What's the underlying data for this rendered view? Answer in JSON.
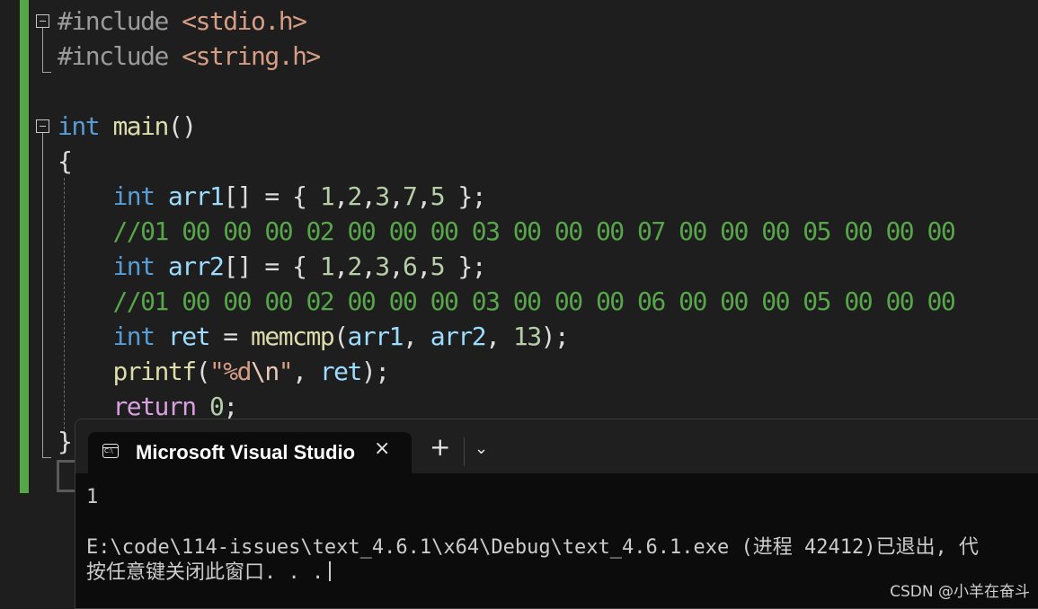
{
  "editor": {
    "lines": [
      {
        "id": "l1",
        "tokens": [
          {
            "t": "#include ",
            "c": "pp"
          },
          {
            "t": "<stdio.h>",
            "c": "inc"
          }
        ]
      },
      {
        "id": "l2",
        "tokens": [
          {
            "t": "#include ",
            "c": "pp"
          },
          {
            "t": "<string.h>",
            "c": "inc"
          }
        ]
      },
      {
        "id": "l3",
        "tokens": []
      },
      {
        "id": "l4",
        "tokens": [
          {
            "t": "int",
            "c": "kw"
          },
          {
            "t": " ",
            "c": "pl"
          },
          {
            "t": "main",
            "c": "fn"
          },
          {
            "t": "()",
            "c": "pl"
          }
        ]
      },
      {
        "id": "l5",
        "tokens": [
          {
            "t": "{",
            "c": "pl"
          }
        ]
      },
      {
        "id": "l6",
        "tokens": [
          {
            "t": "    ",
            "c": "pl"
          },
          {
            "t": "int",
            "c": "kw"
          },
          {
            "t": " ",
            "c": "pl"
          },
          {
            "t": "arr1",
            "c": "var"
          },
          {
            "t": "[] = { ",
            "c": "pl"
          },
          {
            "t": "1",
            "c": "num"
          },
          {
            "t": ",",
            "c": "pl"
          },
          {
            "t": "2",
            "c": "num"
          },
          {
            "t": ",",
            "c": "pl"
          },
          {
            "t": "3",
            "c": "num"
          },
          {
            "t": ",",
            "c": "pl"
          },
          {
            "t": "7",
            "c": "num"
          },
          {
            "t": ",",
            "c": "pl"
          },
          {
            "t": "5",
            "c": "num"
          },
          {
            "t": " };",
            "c": "pl"
          }
        ]
      },
      {
        "id": "l7",
        "tokens": [
          {
            "t": "    ",
            "c": "pl"
          },
          {
            "t": "//01 00 00 00 02 00 00 00 03 00 00 00 07 00 00 00 05 00 00 00",
            "c": "cm"
          }
        ]
      },
      {
        "id": "l8",
        "tokens": [
          {
            "t": "    ",
            "c": "pl"
          },
          {
            "t": "int",
            "c": "kw"
          },
          {
            "t": " ",
            "c": "pl"
          },
          {
            "t": "arr2",
            "c": "var"
          },
          {
            "t": "[] = { ",
            "c": "pl"
          },
          {
            "t": "1",
            "c": "num"
          },
          {
            "t": ",",
            "c": "pl"
          },
          {
            "t": "2",
            "c": "num"
          },
          {
            "t": ",",
            "c": "pl"
          },
          {
            "t": "3",
            "c": "num"
          },
          {
            "t": ",",
            "c": "pl"
          },
          {
            "t": "6",
            "c": "num"
          },
          {
            "t": ",",
            "c": "pl"
          },
          {
            "t": "5",
            "c": "num"
          },
          {
            "t": " };",
            "c": "pl"
          }
        ]
      },
      {
        "id": "l9",
        "tokens": [
          {
            "t": "    ",
            "c": "pl"
          },
          {
            "t": "//01 00 00 00 02 00 00 00 03 00 00 00 06 00 00 00 05 00 00 00",
            "c": "cm"
          }
        ]
      },
      {
        "id": "l10",
        "tokens": [
          {
            "t": "    ",
            "c": "pl"
          },
          {
            "t": "int",
            "c": "kw"
          },
          {
            "t": " ",
            "c": "pl"
          },
          {
            "t": "ret",
            "c": "var"
          },
          {
            "t": " = ",
            "c": "pl"
          },
          {
            "t": "memcmp",
            "c": "fn"
          },
          {
            "t": "(",
            "c": "pl"
          },
          {
            "t": "arr1",
            "c": "var"
          },
          {
            "t": ", ",
            "c": "pl"
          },
          {
            "t": "arr2",
            "c": "var"
          },
          {
            "t": ", ",
            "c": "pl"
          },
          {
            "t": "13",
            "c": "num"
          },
          {
            "t": ");",
            "c": "pl"
          }
        ]
      },
      {
        "id": "l11",
        "tokens": [
          {
            "t": "    ",
            "c": "pl"
          },
          {
            "t": "printf",
            "c": "fn"
          },
          {
            "t": "(",
            "c": "pl"
          },
          {
            "t": "\"%d",
            "c": "str"
          },
          {
            "t": "\\n",
            "c": "esc"
          },
          {
            "t": "\"",
            "c": "str"
          },
          {
            "t": ", ",
            "c": "pl"
          },
          {
            "t": "ret",
            "c": "var"
          },
          {
            "t": ");",
            "c": "pl"
          }
        ]
      },
      {
        "id": "l12",
        "tokens": [
          {
            "t": "    ",
            "c": "pl"
          },
          {
            "t": "return",
            "c": "kw2"
          },
          {
            "t": " ",
            "c": "pl"
          },
          {
            "t": "0",
            "c": "num"
          },
          {
            "t": ";",
            "c": "pl"
          }
        ]
      },
      {
        "id": "l13",
        "tokens": [
          {
            "t": "}",
            "c": "pl"
          }
        ]
      }
    ],
    "colors": {
      "background": "#1e1e1e",
      "keyword": "#569cd6",
      "comment": "#57a64a",
      "function": "#dcdcaa",
      "variable": "#9cdcfe",
      "number": "#b5cea8",
      "string": "#d69d85",
      "change_bar": "#57a64a"
    }
  },
  "terminal": {
    "tab_title": "Microsoft Visual Studio",
    "close_icon": "×",
    "new_tab_icon": "+",
    "dropdown_icon": "⌄",
    "output_line1": "1",
    "output_line2": "E:\\code\\114-issues\\text_4.6.1\\x64\\Debug\\text_4.6.1.exe (进程 42412)已退出, 代",
    "output_line3": "按任意键关闭此窗口. . ."
  },
  "watermark": "CSDN @小羊在奋斗"
}
